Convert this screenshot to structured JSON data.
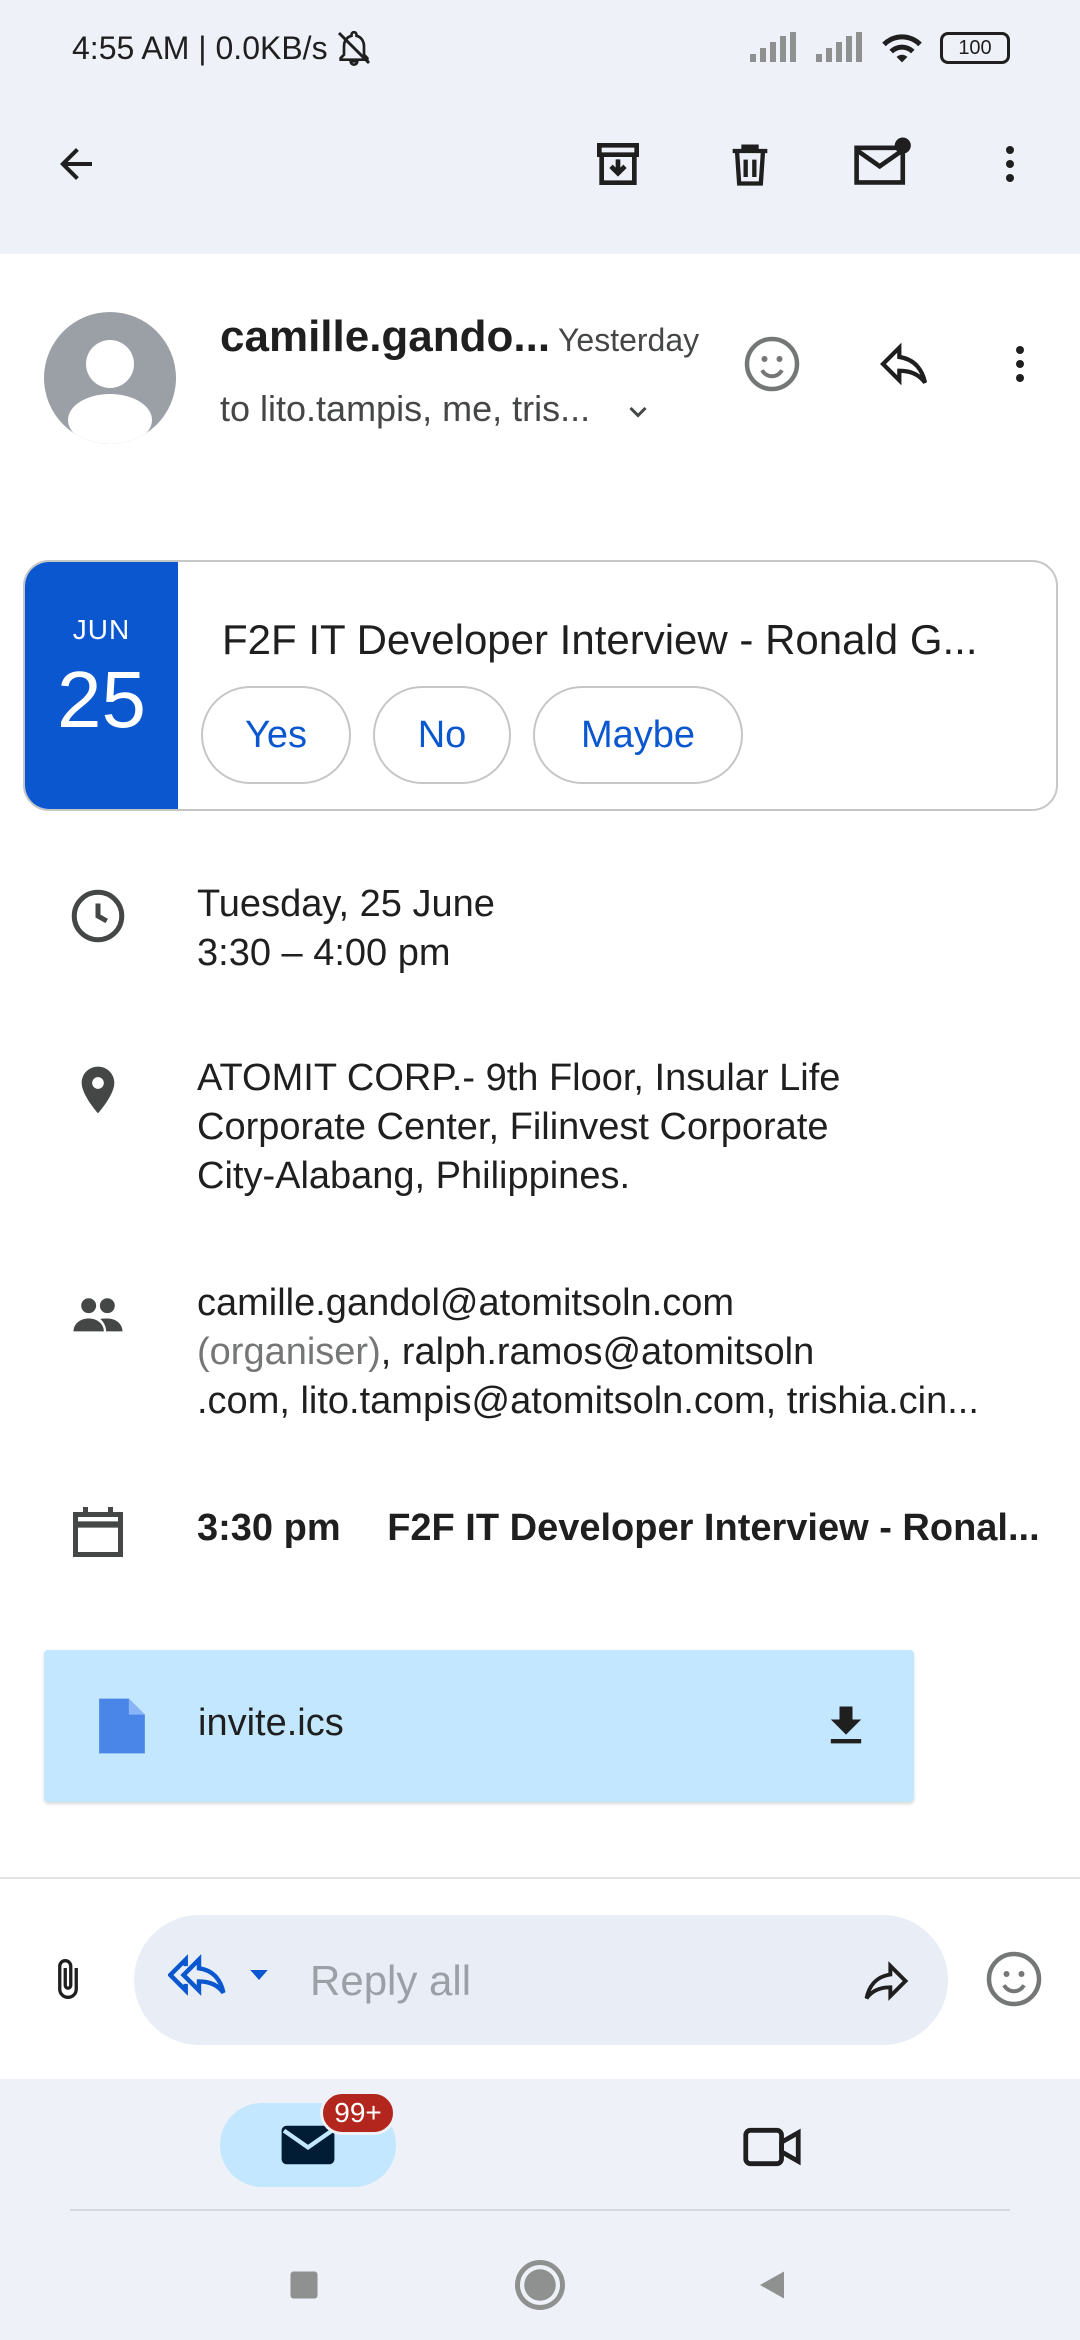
{
  "status_bar": {
    "time_speed": "4:55 AM | 0.0KB/s",
    "battery": "100"
  },
  "sender": {
    "name": "camille.gando...",
    "date": "Yesterday",
    "recipients": "to lito.tampis, me, tris..."
  },
  "invite": {
    "month": "JUN",
    "day": "25",
    "title": "F2F IT Developer Interview - Ronald G...",
    "rsvp_yes": "Yes",
    "rsvp_no": "No",
    "rsvp_maybe": "Maybe"
  },
  "details": {
    "date_line": "Tuesday, 25 June",
    "time_line": "3:30 – 4:00 pm",
    "location_line1": "ATOMIT CORP.- 9th Floor, Insular Life",
    "location_line2": "Corporate Center, Filinvest Corporate",
    "location_line3": "City-Alabang, Philippines.",
    "guests_line1": "camille.gandol@atomitsoln.com",
    "guests_organiser": "(organiser)",
    "guests_line2_rest": ", ralph.ramos@atomitsoln",
    "guests_line3": ".com, lito.tampis@atomitsoln.com, trishia.cin...",
    "agenda_time": "3:30 pm",
    "agenda_title": "F2F IT Developer Interview - Ronal..."
  },
  "attachment": {
    "filename": "invite.ics"
  },
  "reply": {
    "placeholder": "Reply all"
  },
  "bottom_nav": {
    "mail_badge": "99+"
  },
  "colors": {
    "accent_blue": "#0b57d0",
    "surface": "#eef1f8",
    "attachment_bg": "#c2e7ff",
    "badge_red": "#b3261e"
  },
  "icons": [
    "back-arrow-icon",
    "archive-icon",
    "delete-icon",
    "mark-unread-icon",
    "more-vert-icon",
    "emoji-icon",
    "reply-icon",
    "clock-icon",
    "location-pin-icon",
    "people-icon",
    "calendar-icon",
    "file-icon",
    "download-icon",
    "attach-icon",
    "reply-all-icon",
    "forward-icon",
    "mail-icon",
    "video-icon"
  ]
}
